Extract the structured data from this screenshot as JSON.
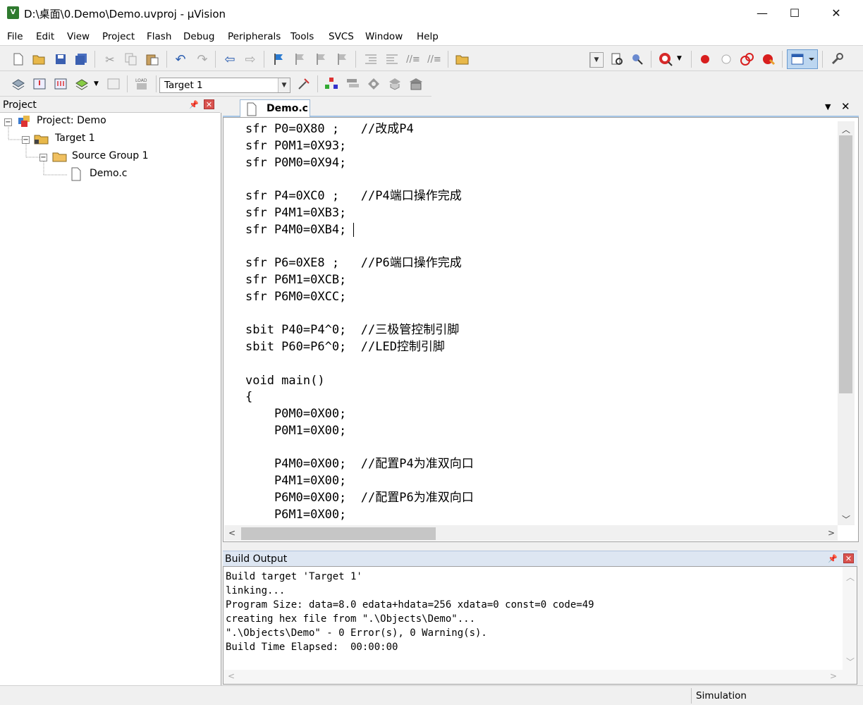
{
  "window": {
    "title": "D:\\桌面\\0.Demo\\Demo.uvproj - µVision",
    "app_icon_text": "V",
    "minimize": "—",
    "maximize": "☐",
    "close": "✕"
  },
  "menu": [
    "File",
    "Edit",
    "View",
    "Project",
    "Flash",
    "Debug",
    "Peripherals",
    "Tools",
    "SVCS",
    "Window",
    "Help"
  ],
  "build_toolbar": {
    "target_select": "Target 1"
  },
  "project_panel": {
    "title": "Project",
    "tree": {
      "root": "Project: Demo",
      "target": "Target 1",
      "group": "Source Group 1",
      "file": "Demo.c"
    }
  },
  "editor": {
    "tab": "Demo.c",
    "current_line_index": 6,
    "lines": [
      "sfr P0=0X80 ;   //改成P4",
      "sfr P0M1=0X93;",
      "sfr P0M0=0X94;",
      "",
      "sfr P4=0XC0 ;   //P4端口操作完成",
      "sfr P4M1=0XB3;",
      "sfr P4M0=0XB4;",
      "",
      "sfr P6=0XE8 ;   //P6端口操作完成",
      "sfr P6M1=0XCB;",
      "sfr P6M0=0XCC;",
      "",
      "sbit P40=P4^0;  //三极管控制引脚",
      "sbit P60=P6^0;  //LED控制引脚",
      "",
      "void main()",
      "{",
      "    P0M0=0X00;",
      "    P0M1=0X00;",
      "",
      "    P4M0=0X00;  //配置P4为准双向口",
      "    P4M1=0X00;",
      "    P6M0=0X00;  //配置P6为准双向口",
      "    P6M1=0X00;"
    ]
  },
  "build_output": {
    "title": "Build Output",
    "lines": [
      "Build target 'Target 1'",
      "linking...",
      "Program Size: data=8.0 edata+hdata=256 xdata=0 const=0 code=49",
      "creating hex file from \".\\Objects\\Demo\"...",
      "\".\\Objects\\Demo\" - 0 Error(s), 0 Warning(s).",
      "Build Time Elapsed:  00:00:00"
    ]
  },
  "status": {
    "mode": "Simulation"
  },
  "colors": {
    "highlight": "#88c4f4",
    "close_button": "#d9534f"
  }
}
